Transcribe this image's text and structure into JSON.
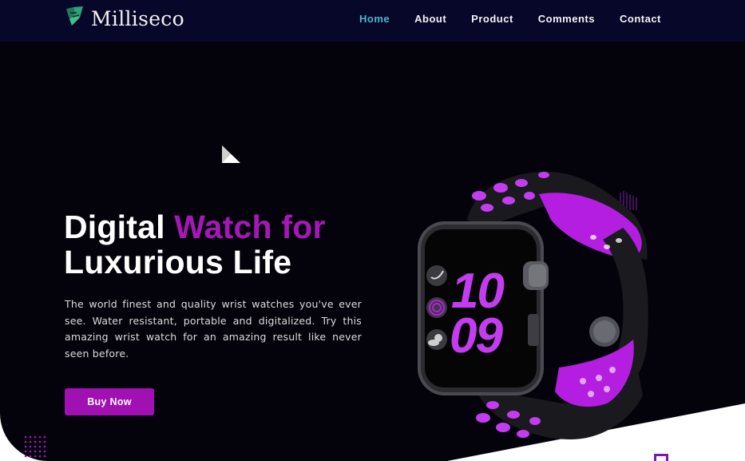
{
  "brand": {
    "name": "Milliseco",
    "logo_icon": "leaf-icon"
  },
  "nav": {
    "items": [
      {
        "label": "Home",
        "active": true
      },
      {
        "label": "About",
        "active": false
      },
      {
        "label": "Product",
        "active": false
      },
      {
        "label": "Comments",
        "active": false
      },
      {
        "label": "Contact",
        "active": false
      }
    ]
  },
  "hero": {
    "title_part1": "Digital",
    "title_accent": "Watch for",
    "title_line2": "Luxurious Life",
    "description": "The world finest and quality wrist watches you've ever see. Water resistant, portable and digitalized. Try this amazing wrist watch for an amazing result like never seen before.",
    "cta_label": "Buy Now"
  },
  "watch": {
    "hour": "10",
    "minute": "09"
  },
  "colors": {
    "background": "#04030b",
    "nav_background": "#070729",
    "accent": "#a617b7",
    "active_nav": "#4ab6c9"
  }
}
